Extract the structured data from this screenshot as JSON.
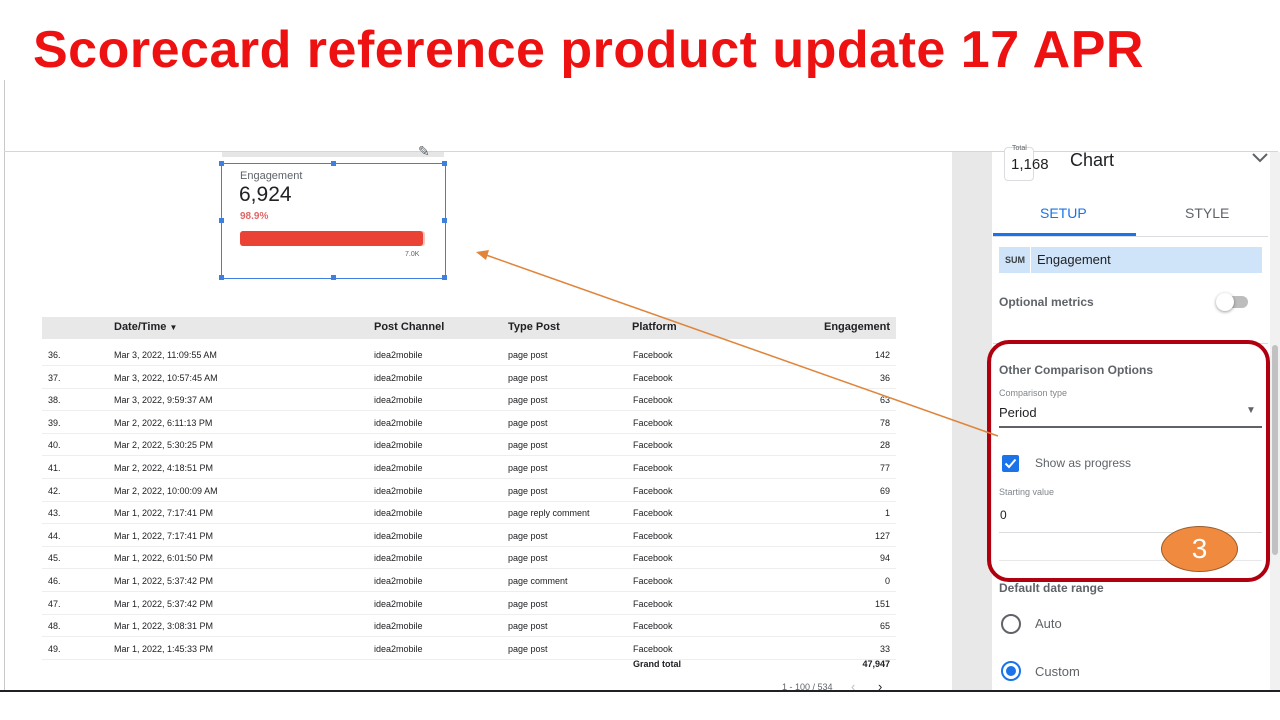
{
  "slide": {
    "title": "Scorecard reference product update 17 APR",
    "title_color": "#ee1111",
    "annotation_color": "#b00010",
    "step_badge": "3",
    "step_badge_color": "#f08a3e",
    "arrow_color": "#e0843a"
  },
  "scorecard": {
    "label": "Engagement",
    "value": "6,924",
    "progress_pct_text": "98.9%",
    "progress_fraction": 0.989,
    "target_label": "7.0K",
    "bar_color": "#ea4335",
    "edit_icon": "pencil-icon"
  },
  "table": {
    "columns": [
      "Date/Time",
      "Post Channel",
      "Type Post",
      "Platform",
      "Engagement"
    ],
    "sort_icon": "sort-desc-icon",
    "rows": [
      [
        "36.",
        "Mar 3, 2022, 11:09:55 AM",
        "idea2mobile",
        "page post",
        "Facebook",
        "142"
      ],
      [
        "37.",
        "Mar 3, 2022, 10:57:45 AM",
        "idea2mobile",
        "page post",
        "Facebook",
        "36"
      ],
      [
        "38.",
        "Mar 3, 2022, 9:59:37 AM",
        "idea2mobile",
        "page post",
        "Facebook",
        "63"
      ],
      [
        "39.",
        "Mar 2, 2022, 6:11:13 PM",
        "idea2mobile",
        "page post",
        "Facebook",
        "78"
      ],
      [
        "40.",
        "Mar 2, 2022, 5:30:25 PM",
        "idea2mobile",
        "page post",
        "Facebook",
        "28"
      ],
      [
        "41.",
        "Mar 2, 2022, 4:18:51 PM",
        "idea2mobile",
        "page post",
        "Facebook",
        "77"
      ],
      [
        "42.",
        "Mar 2, 2022, 10:00:09 AM",
        "idea2mobile",
        "page post",
        "Facebook",
        "69"
      ],
      [
        "43.",
        "Mar 1, 2022, 7:17:41 PM",
        "idea2mobile",
        "page reply comment",
        "Facebook",
        "1"
      ],
      [
        "44.",
        "Mar 1, 2022, 7:17:41 PM",
        "idea2mobile",
        "page post",
        "Facebook",
        "127"
      ],
      [
        "45.",
        "Mar 1, 2022, 6:01:50 PM",
        "idea2mobile",
        "page post",
        "Facebook",
        "94"
      ],
      [
        "46.",
        "Mar 1, 2022, 5:37:42 PM",
        "idea2mobile",
        "page comment",
        "Facebook",
        "0"
      ],
      [
        "47.",
        "Mar 1, 2022, 5:37:42 PM",
        "idea2mobile",
        "page post",
        "Facebook",
        "151"
      ],
      [
        "48.",
        "Mar 1, 2022, 3:08:31 PM",
        "idea2mobile",
        "page post",
        "Facebook",
        "65"
      ],
      [
        "49.",
        "Mar 1, 2022, 1:45:33 PM",
        "idea2mobile",
        "page post",
        "Facebook",
        "33"
      ]
    ],
    "grand_total_label": "Grand total",
    "grand_total_value": "47,947",
    "pagination": "1 - 100 / 534",
    "prev_icon": "chevron-left-icon",
    "next_icon": "chevron-right-icon"
  },
  "panel": {
    "chart_icon_label": "Total",
    "chart_icon_value": "1,168",
    "chart_title": "Chart",
    "chevron_icon": "chevron-down-icon",
    "tabs": [
      {
        "label": "SETUP",
        "active": true
      },
      {
        "label": "STYLE",
        "active": false
      }
    ],
    "metric": {
      "aggregation": "SUM",
      "name": "Engagement"
    },
    "optional_metrics_label": "Optional metrics",
    "optional_metrics_on": false,
    "other_comparison_title": "Other Comparison Options",
    "comparison_type_label": "Comparison type",
    "comparison_type_value": "Period",
    "show_as_progress_label": "Show as progress",
    "show_as_progress_checked": true,
    "starting_value_label": "Starting value",
    "starting_value": "0",
    "default_date_range_label": "Default date range",
    "date_range_options": [
      {
        "label": "Auto",
        "selected": false
      },
      {
        "label": "Custom",
        "selected": true
      }
    ],
    "accent_color": "#1a73e8"
  }
}
